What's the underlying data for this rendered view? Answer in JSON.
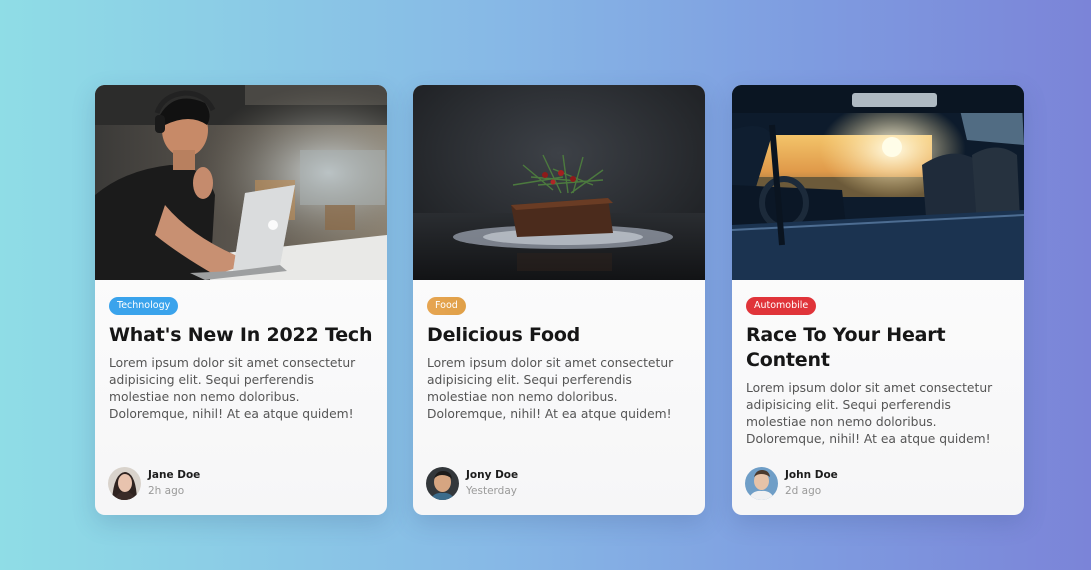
{
  "cards": [
    {
      "tag": "Technology",
      "tag_color": "#3aa3ec",
      "title": "What's New In 2022 Tech",
      "description": "Lorem ipsum dolor sit amet consectetur adipisicing elit. Sequi perferendis molestiae non nemo doloribus. Doloremque, nihil! At ea atque quidem!",
      "author": "Jane Doe",
      "time": "2h ago",
      "image": "man-with-laptop-photo"
    },
    {
      "tag": "Food",
      "tag_color": "#e5a24e",
      "title": "Delicious Food",
      "description": "Lorem ipsum dolor sit amet consectetur adipisicing elit. Sequi perferendis molestiae non nemo doloribus. Doloremque, nihil! At ea atque quidem!",
      "author": "Jony Doe",
      "time": "Yesterday",
      "image": "cake-photo"
    },
    {
      "tag": "Automobile",
      "tag_color": "#e0343a",
      "title": "Race To Your Heart Content",
      "description": "Lorem ipsum dolor sit amet consectetur adipisicing elit. Sequi perferendis molestiae non nemo doloribus. Doloremque, nihil! At ea atque quidem!",
      "author": "John Doe",
      "time": "2d ago",
      "image": "car-interior-photo"
    }
  ]
}
